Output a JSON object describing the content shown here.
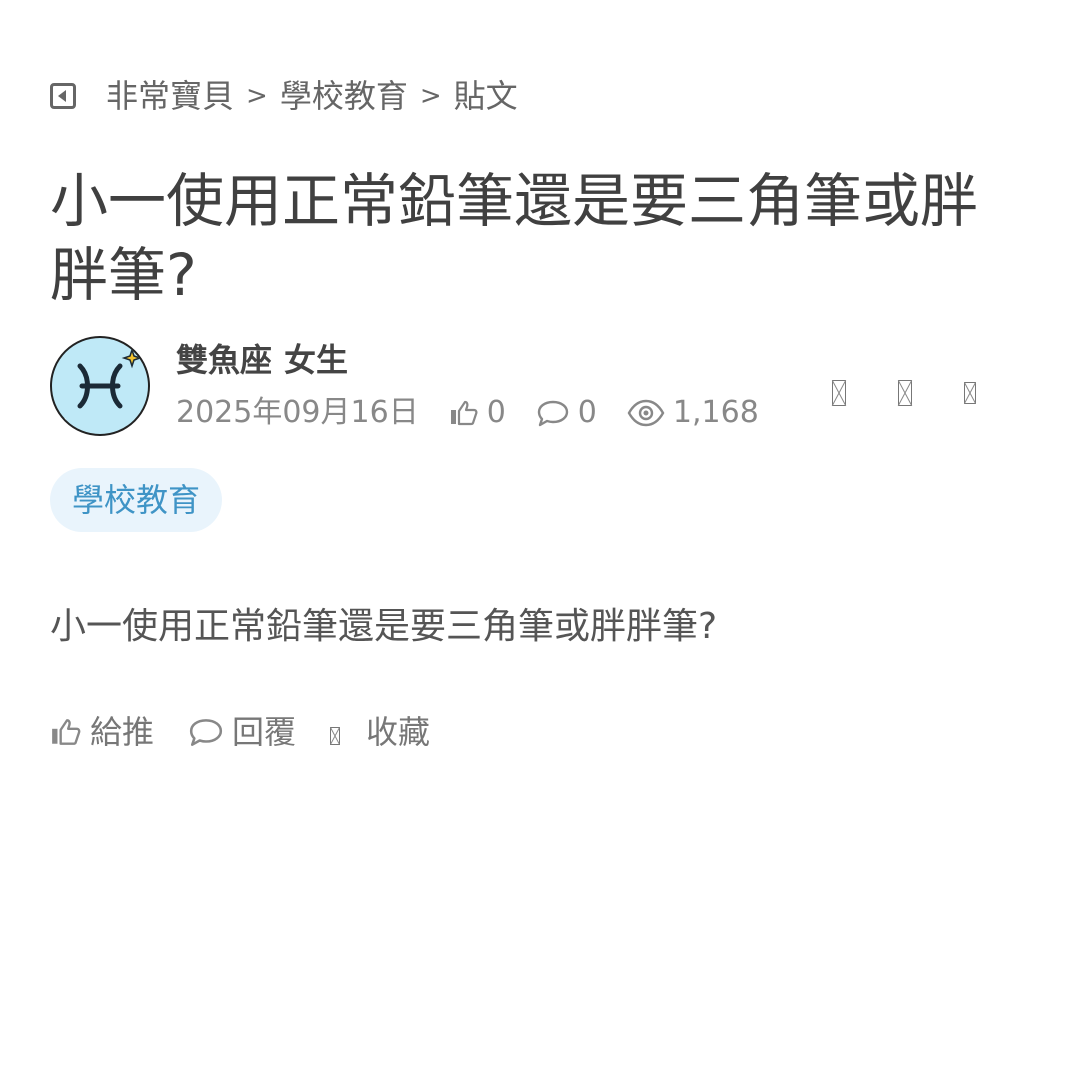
{
  "breadcrumb": {
    "items": [
      "非常寶貝",
      "學校教育",
      "貼文"
    ],
    "separator": ">"
  },
  "post": {
    "title": "小一使用正常鉛筆還是要三角筆或胖胖筆?",
    "author": {
      "name": "雙魚座",
      "gender": "女生",
      "avatar_icon": "pisces-icon"
    },
    "date": "2025年09月16日",
    "likes": "0",
    "comments": "0",
    "views": "1,168",
    "tag": "學校教育",
    "content": "小一使用正常鉛筆還是要三角筆或胖胖筆?"
  },
  "actions": {
    "like_label": "給推",
    "reply_label": "回覆",
    "save_label": "收藏"
  },
  "colors": {
    "tag_bg": "#e9f4fc",
    "tag_text": "#3f94c6",
    "avatar_bg": "#bfe9f7"
  }
}
